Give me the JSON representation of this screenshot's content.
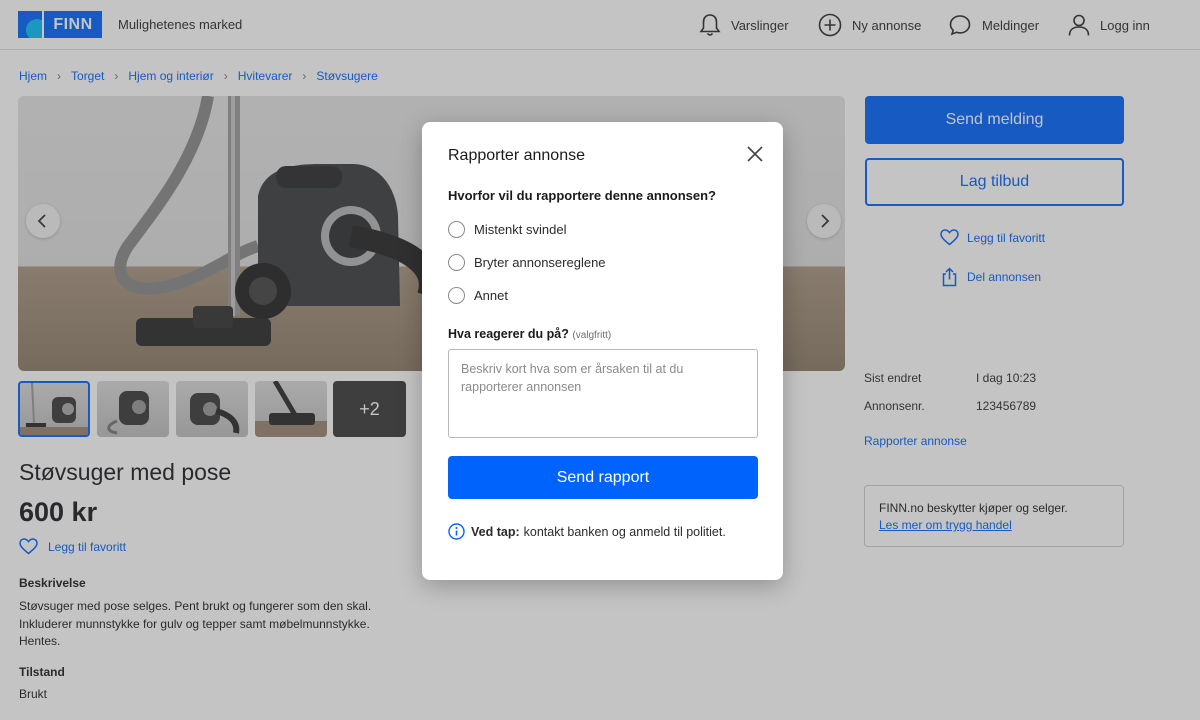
{
  "header": {
    "logo_text": "FINN",
    "tagline": "Mulighetenes marked",
    "nav": [
      {
        "label": "Varslinger",
        "icon": "bell-icon"
      },
      {
        "label": "Ny annonse",
        "icon": "plus-circle-icon"
      },
      {
        "label": "Meldinger",
        "icon": "chat-icon"
      },
      {
        "label": "Logg inn",
        "icon": "user-icon"
      }
    ]
  },
  "breadcrumb": [
    "Hjem",
    "Torget",
    "Hjem og interiør",
    "Hvitevarer",
    "Støvsugere"
  ],
  "gallery": {
    "more_label": "+2"
  },
  "listing": {
    "title": "Støvsuger med pose",
    "price": "600 kr",
    "favorite_label": "Legg til favoritt",
    "description_heading": "Beskrivelse",
    "description_lines": [
      "Støvsuger med pose selges. Pent brukt og fungerer som den skal.",
      "Inkluderer munnstykke for gulv og tepper samt møbelmunnstykke.",
      "Hentes."
    ],
    "condition_heading": "Tilstand",
    "condition_value": "Brukt"
  },
  "sidebar": {
    "send_message": "Send melding",
    "make_offer": "Lag tilbud",
    "favorite": "Legg til favoritt",
    "share": "Del annonsen",
    "last_changed_label": "Sist endret",
    "last_changed_value": "I dag 10:23",
    "ad_number_label": "Annonsenr.",
    "ad_number_value": "123456789",
    "report_link": "Rapporter annonse",
    "safe_text": "FINN.no beskytter kjøper og selger.",
    "safe_link": "Les mer om trygg handel"
  },
  "modal": {
    "title": "Rapporter annonse",
    "question": "Hvorfor vil du rapportere denne annonsen?",
    "options": [
      "Mistenkt svindel",
      "Bryter annonsereglene",
      "Annet"
    ],
    "comment_label": "Hva reagerer du på?",
    "comment_optional": "(valgfritt)",
    "comment_placeholder": "Beskriv kort hva som er årsaken til at du rapporterer annonsen",
    "submit": "Send rapport",
    "info_bold": "Ved tap:",
    "info_text": "kontakt banken og anmeld til politiet."
  },
  "colors": {
    "brand_blue": "#0063fb",
    "overlay": "rgba(70,70,70,0.32)"
  }
}
